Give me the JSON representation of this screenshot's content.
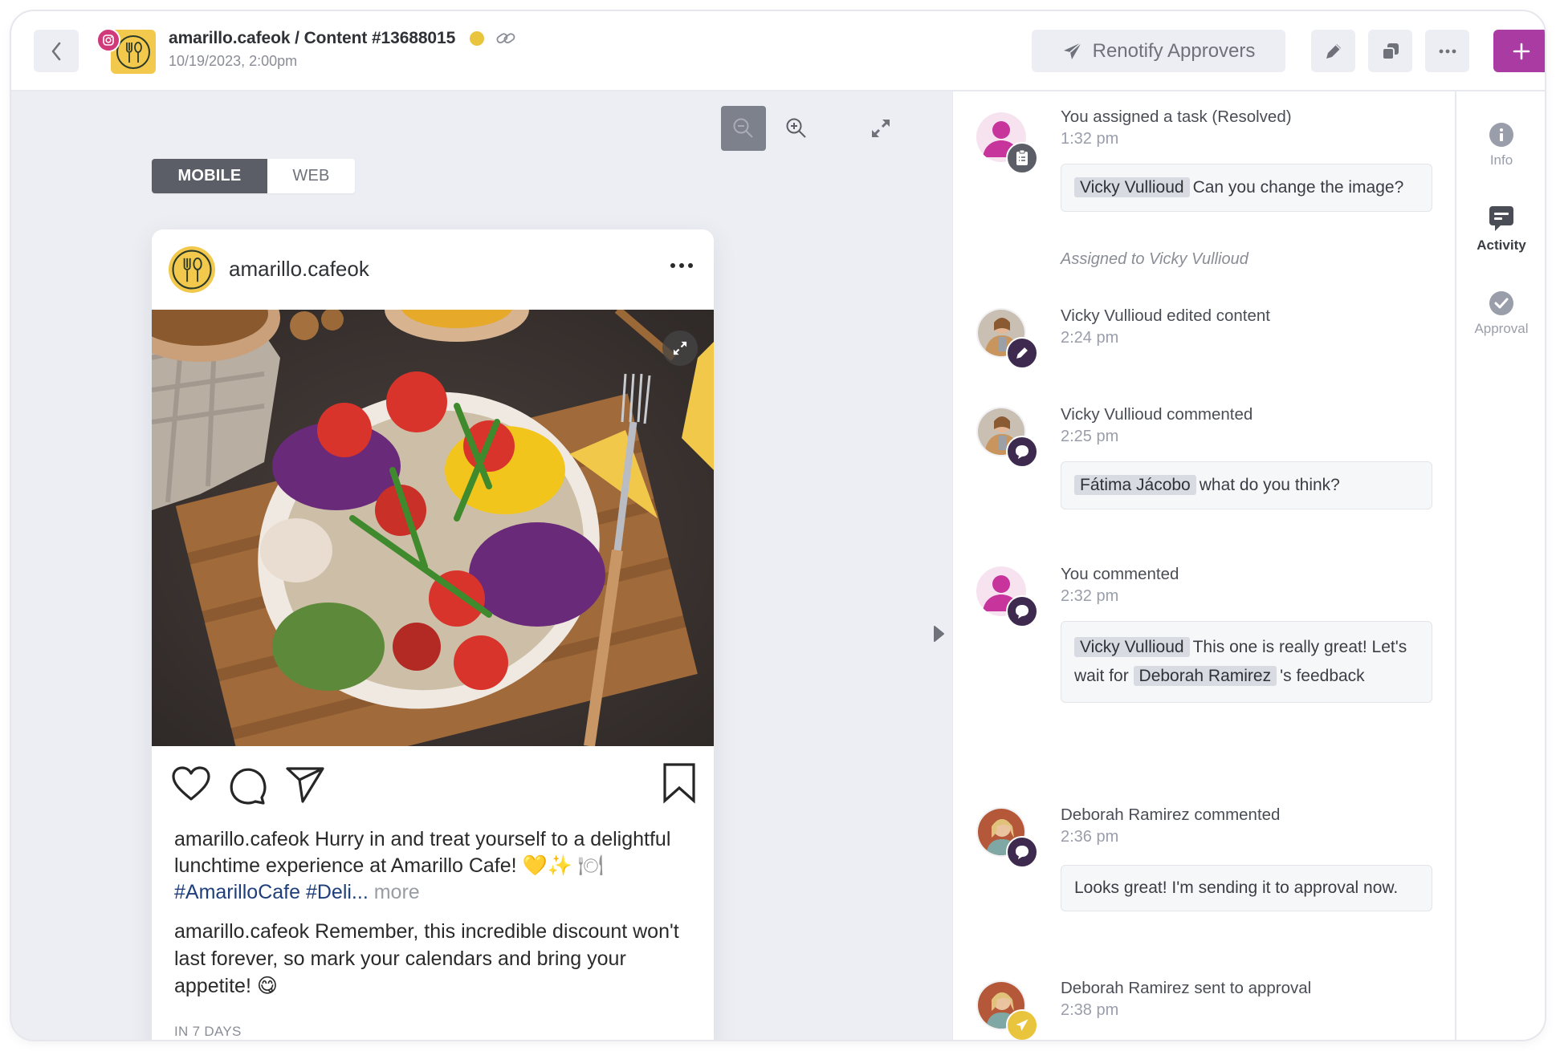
{
  "header": {
    "title": "amarillo.cafeok / Content #13688015",
    "subtitle": "10/19/2023, 2:00pm",
    "status_color": "#e9c43d",
    "renotify_label": "Renotify Approvers",
    "accent_color": "#a93ba3",
    "icons": [
      "back-icon",
      "instagram-icon",
      "link-icon",
      "paper-plane-icon",
      "pencil-icon",
      "copy-icon",
      "more-icon",
      "plus-icon"
    ]
  },
  "preview": {
    "view_options": [
      "MOBILE",
      "WEB"
    ],
    "selected_view": "MOBILE",
    "post": {
      "username": "amarillo.cafeok",
      "caption_user": "amarillo.cafeok",
      "caption_text": "Hurry in and treat yourself to a delightful lunchtime experience at Amarillo Cafe! 💛✨",
      "caption_emoji_plate": "🍽",
      "caption_hashtags": "#AmarilloCafe #Deli...",
      "caption_more": "more",
      "comment_user": "amarillo.cafeok",
      "comment_text": "Remember, this incredible discount won't last forever, so mark your calendars and bring your appetite! 😋",
      "schedule_label": "IN 7 DAYS",
      "image_alt": "Salad bowl with tomatoes, red cabbage, yellow pepper, green onion, chicken on a wooden board with fork and lemon"
    }
  },
  "activity": [
    {
      "actor": "You",
      "title": "You assigned a task (Resolved)",
      "time": "1:32 pm",
      "badge_icon": "clipboard-icon",
      "mention": "Vicky Vullioud",
      "message": "Can you change the image?",
      "note": "Assigned to Vicky Vullioud"
    },
    {
      "actor": "Vicky Vullioud",
      "title": "Vicky Vullioud edited content",
      "time": "2:24 pm",
      "badge_icon": "pencil-icon"
    },
    {
      "actor": "Vicky Vullioud",
      "title": "Vicky Vullioud commented",
      "time": "2:25 pm",
      "badge_icon": "comment-icon",
      "mention": "Fátima Jácobo",
      "message": "what do you think?"
    },
    {
      "actor": "You",
      "title": "You commented",
      "time": "2:32 pm",
      "badge_icon": "comment-icon",
      "mention": "Vicky Vullioud",
      "message": "This one is really great!",
      "message2_prefix": "Let's wait for",
      "mention2": "Deborah Ramirez",
      "message2_suffix": "'s feedback"
    },
    {
      "actor": "Deborah Ramirez",
      "title": "Deborah Ramirez commented",
      "time": "2:36 pm",
      "badge_icon": "comment-icon",
      "message": "Looks great! I'm sending it to approval now."
    },
    {
      "actor": "Deborah Ramirez",
      "title": "Deborah Ramirez sent to approval",
      "time": "2:38 pm",
      "badge_icon": "send-icon"
    }
  ],
  "rail": {
    "items": [
      {
        "label": "Info",
        "icon": "info-icon",
        "active": false
      },
      {
        "label": "Activity",
        "icon": "activity-icon",
        "active": true
      },
      {
        "label": "Approval",
        "icon": "check-circle-icon",
        "active": false
      }
    ]
  }
}
